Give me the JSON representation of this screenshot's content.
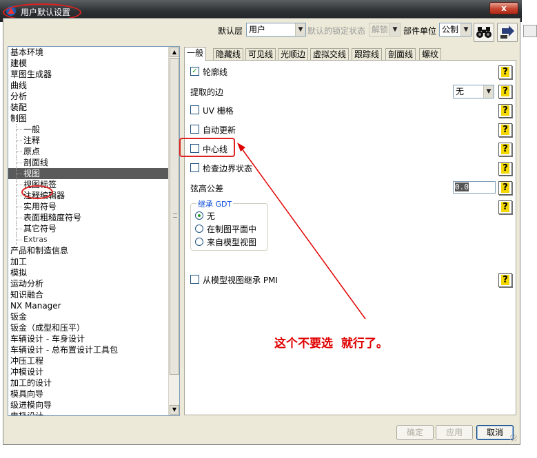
{
  "window": {
    "title": "用户默认设置",
    "close_glyph": "x"
  },
  "toolbar": {
    "layer_label": "默认层",
    "layer_value": "用户",
    "lock_label": "默认的锁定状态",
    "lock_value": "解锁",
    "units_label": "部件单位",
    "units_value": "公制",
    "search_icon": "binoculars-icon",
    "export_icon": "export-icon"
  },
  "tree": {
    "items": [
      {
        "label": "基本环境",
        "level": 0
      },
      {
        "label": "建模",
        "level": 0
      },
      {
        "label": "草图生成器",
        "level": 0
      },
      {
        "label": "曲线",
        "level": 0
      },
      {
        "label": "分析",
        "level": 0
      },
      {
        "label": "装配",
        "level": 0
      },
      {
        "label": "制图",
        "level": 0
      },
      {
        "label": "一般",
        "level": 1
      },
      {
        "label": "注释",
        "level": 1
      },
      {
        "label": "原点",
        "level": 1
      },
      {
        "label": "剖面线",
        "level": 1
      },
      {
        "label": "视图",
        "level": 1,
        "selected": true
      },
      {
        "label": "视图标签",
        "level": 1
      },
      {
        "label": "注释编辑器",
        "level": 1
      },
      {
        "label": "实用符号",
        "level": 1
      },
      {
        "label": "表面粗糙度符号",
        "level": 1
      },
      {
        "label": "其它符号",
        "level": 1
      },
      {
        "label": "Extras",
        "level": 1,
        "extras": true
      },
      {
        "label": "产品和制造信息",
        "level": 0
      },
      {
        "label": "加工",
        "level": 0
      },
      {
        "label": "模拟",
        "level": 0
      },
      {
        "label": "运动分析",
        "level": 0
      },
      {
        "label": "知识融合",
        "level": 0
      },
      {
        "label": "NX Manager",
        "level": 0
      },
      {
        "label": "钣金",
        "level": 0
      },
      {
        "label": "钣金（成型和压平）",
        "level": 0
      },
      {
        "label": "车辆设计 - 车身设计",
        "level": 0
      },
      {
        "label": "车辆设计 - 总布置设计工具包",
        "level": 0
      },
      {
        "label": "冲压工程",
        "level": 0
      },
      {
        "label": "冲模设计",
        "level": 0
      },
      {
        "label": "加工的设计",
        "level": 0
      },
      {
        "label": "模具向导",
        "level": 0
      },
      {
        "label": "级进模向导",
        "level": 0
      },
      {
        "label": "电极设计",
        "level": 0
      }
    ]
  },
  "tabs": [
    "一般",
    "隐藏线",
    "可见线",
    "光顺边",
    "虚拟交线",
    "跟踪线",
    "剖面线",
    "螺纹"
  ],
  "active_tab": 0,
  "options": {
    "silhouettes": {
      "label": "轮廓线",
      "checked": true
    },
    "extracted_edges": {
      "label": "提取的边",
      "value": "无"
    },
    "uv_grid": {
      "label": "UV 栅格",
      "checked": false
    },
    "auto_update": {
      "label": "自动更新",
      "checked": false
    },
    "centerlines": {
      "label": "中心线",
      "checked": false
    },
    "boundary_status": {
      "label": "检查边界状态",
      "checked": false
    },
    "chord_tolerance": {
      "label": "弦高公差",
      "value": "0.0"
    },
    "inherit_gdt": {
      "title": "继承 GDT",
      "choices": [
        "无",
        "在制图平面中",
        "来自模型视图"
      ],
      "selected": 0
    },
    "inherit_pmi": {
      "label": "从模型视图继承 PMI",
      "checked": false
    },
    "help_glyph": "?"
  },
  "annotation": "这个不要选  就行了。",
  "buttons": {
    "ok": "确定",
    "apply": "应用",
    "cancel": "取消"
  },
  "colors": {
    "annotation": "#e00000",
    "titlebar": "#2e3134",
    "selection": "#5a5a5a"
  }
}
